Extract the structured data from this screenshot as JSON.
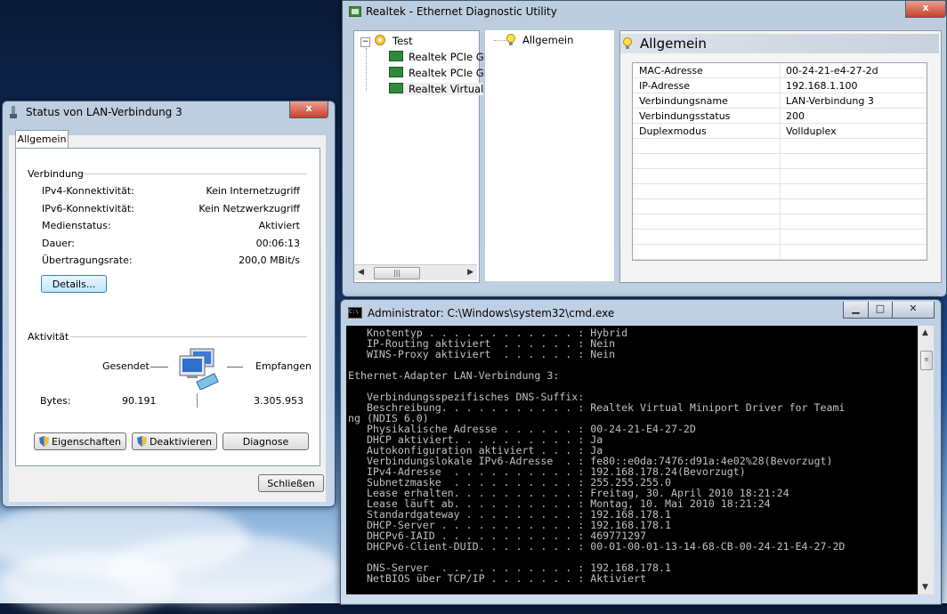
{
  "status_window": {
    "title": "Status von LAN-Verbindung 3",
    "tab": "Allgemein",
    "connection_header": "Verbindung",
    "rows": [
      {
        "label": "IPv4-Konnektivität:",
        "value": "Kein Internetzugriff"
      },
      {
        "label": "IPv6-Konnektivität:",
        "value": "Kein Netzwerkzugriff"
      },
      {
        "label": "Medienstatus:",
        "value": "Aktiviert"
      },
      {
        "label": "Dauer:",
        "value": "00:06:13"
      },
      {
        "label": "Übertragungsrate:",
        "value": "200,0 MBit/s"
      }
    ],
    "details_button": "Details...",
    "activity_header": "Aktivität",
    "sent_label": "Gesendet",
    "received_label": "Empfangen",
    "bytes_label": "Bytes:",
    "bytes_sent": "90.191",
    "bytes_received": "3.305.953",
    "properties_button": "Eigenschaften",
    "disable_button": "Deaktivieren",
    "diagnose_button": "Diagnose",
    "close_button": "Schließen"
  },
  "realtek_window": {
    "title": "Realtek - Ethernet Diagnostic Utility",
    "tree": {
      "root": "Test",
      "children": [
        "Realtek PCIe GE",
        "Realtek PCIe GE",
        "Realtek Virtual"
      ]
    },
    "middle_item": "Allgemein",
    "header": "Allgemein",
    "properties": [
      {
        "key": "MAC-Adresse",
        "value": "00-24-21-e4-27-2d"
      },
      {
        "key": "IP-Adresse",
        "value": "192.168.1.100"
      },
      {
        "key": "Verbindungsname",
        "value": "LAN-Verbindung 3"
      },
      {
        "key": "Verbindungsstatus",
        "value": "200"
      },
      {
        "key": "Duplexmodus",
        "value": "Vollduplex"
      },
      {
        "key": "",
        "value": ""
      },
      {
        "key": "",
        "value": ""
      },
      {
        "key": "",
        "value": ""
      },
      {
        "key": "",
        "value": ""
      },
      {
        "key": "",
        "value": ""
      },
      {
        "key": "",
        "value": ""
      },
      {
        "key": "",
        "value": ""
      },
      {
        "key": "",
        "value": ""
      }
    ]
  },
  "cmd_window": {
    "title": "Administrator: C:\\Windows\\system32\\cmd.exe",
    "icon_text": "C:\\",
    "lines": [
      "   Knotentyp . . . . . . . . . . . . : Hybrid",
      "   IP-Routing aktiviert  . . . . . . : Nein",
      "   WINS-Proxy aktiviert  . . . . . . : Nein",
      "",
      "Ethernet-Adapter LAN-Verbindung 3:",
      "",
      "   Verbindungsspezifisches DNS-Suffix:",
      "   Beschreibung. . . . . . . . . . . : Realtek Virtual Miniport Driver for Teami",
      "ng (NDIS 6.0)",
      "   Physikalische Adresse . . . . . . : 00-24-21-E4-27-2D",
      "   DHCP aktiviert. . . . . . . . . . : Ja",
      "   Autokonfiguration aktiviert . . . : Ja",
      "   Verbindungslokale IPv6-Adresse  . : fe80::e0da:7476:d91a:4e02%28(Bevorzugt)",
      "   IPv4-Adresse  . . . . . . . . . . : 192.168.178.24(Bevorzugt)",
      "   Subnetzmaske  . . . . . . . . . . : 255.255.255.0",
      "   Lease erhalten. . . . . . . . . . : Freitag, 30. April 2010 18:21:24",
      "   Lease läuft ab. . . . . . . . . . : Montag, 10. Mai 2010 18:21:24",
      "   Standardgateway . . . . . . . . . : 192.168.178.1",
      "   DHCP-Server . . . . . . . . . . . : 192.168.178.1",
      "   DHCPv6-IAID . . . . . . . . . . . : 469771297",
      "   DHCPv6-Client-DUID. . . . . . . . : 00-01-00-01-13-14-68-CB-00-24-21-E4-27-2D",
      "",
      "   DNS-Server  . . . . . . . . . . . : 192.168.178.1",
      "   NetBIOS über TCP/IP . . . . . . . : Aktiviert"
    ]
  }
}
